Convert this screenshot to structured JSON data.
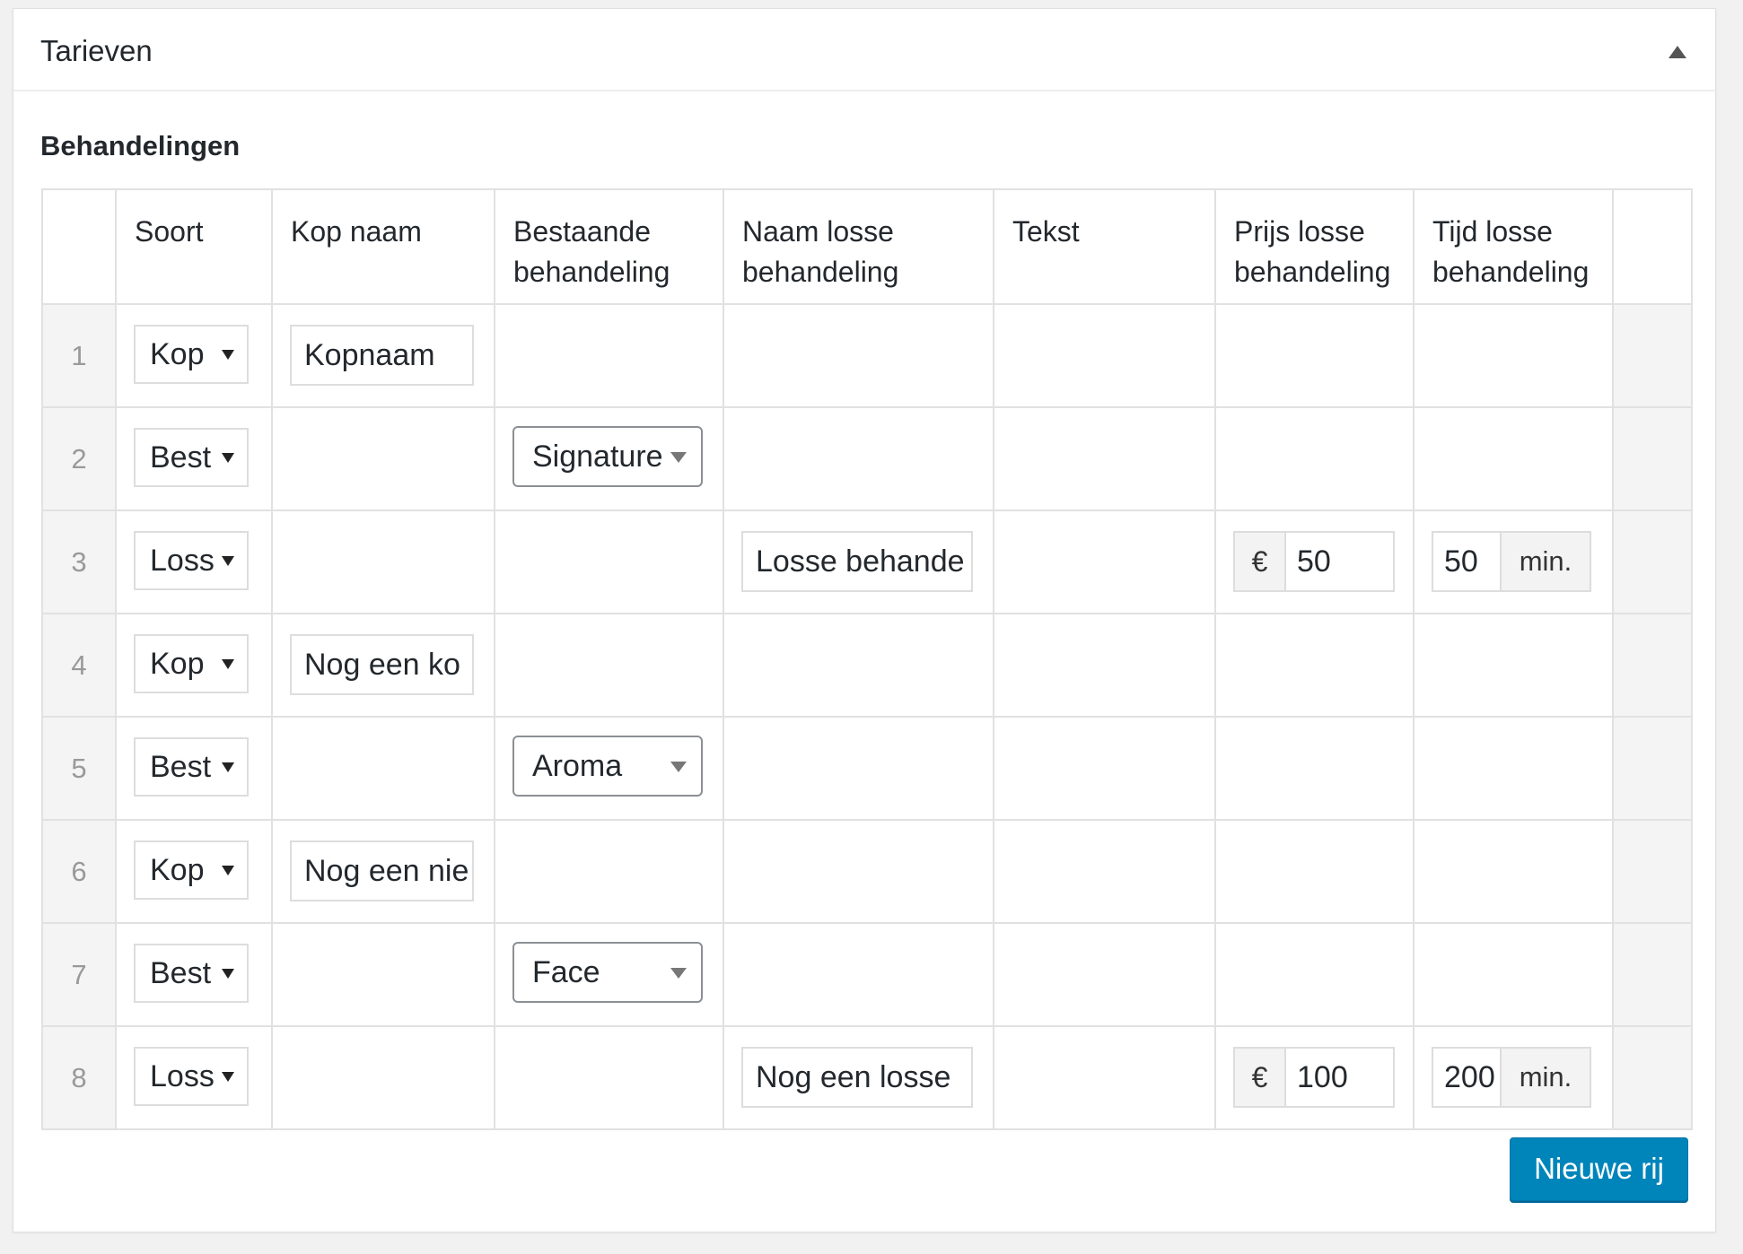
{
  "panel": {
    "title": "Tarieven"
  },
  "section": {
    "title": "Behandelingen"
  },
  "table": {
    "headers": [
      "",
      "Soort",
      "Kop naam",
      "Bestaande behandeling",
      "Naam losse behandeling",
      "Tekst",
      "Prijs losse behandeling",
      "Tijd losse behandeling",
      ""
    ],
    "currency_symbol": "€",
    "time_unit": "min.",
    "rows": [
      {
        "num": "1",
        "soort": "Kop",
        "kop_naam": "Kopnaam"
      },
      {
        "num": "2",
        "soort": "Best",
        "bestaande": "Signature"
      },
      {
        "num": "3",
        "soort": "Loss",
        "naam_losse": "Losse behande",
        "prijs": "50",
        "tijd": "50"
      },
      {
        "num": "4",
        "soort": "Kop",
        "kop_naam": "Nog een ko"
      },
      {
        "num": "5",
        "soort": "Best",
        "bestaande": "Aroma"
      },
      {
        "num": "6",
        "soort": "Kop",
        "kop_naam": "Nog een nie"
      },
      {
        "num": "7",
        "soort": "Best",
        "bestaande": "Face"
      },
      {
        "num": "8",
        "soort": "Loss",
        "naam_losse": "Nog een losse",
        "prijs": "100",
        "tijd": "200"
      }
    ]
  },
  "actions": {
    "new_row_label": "Nieuwe rij"
  }
}
